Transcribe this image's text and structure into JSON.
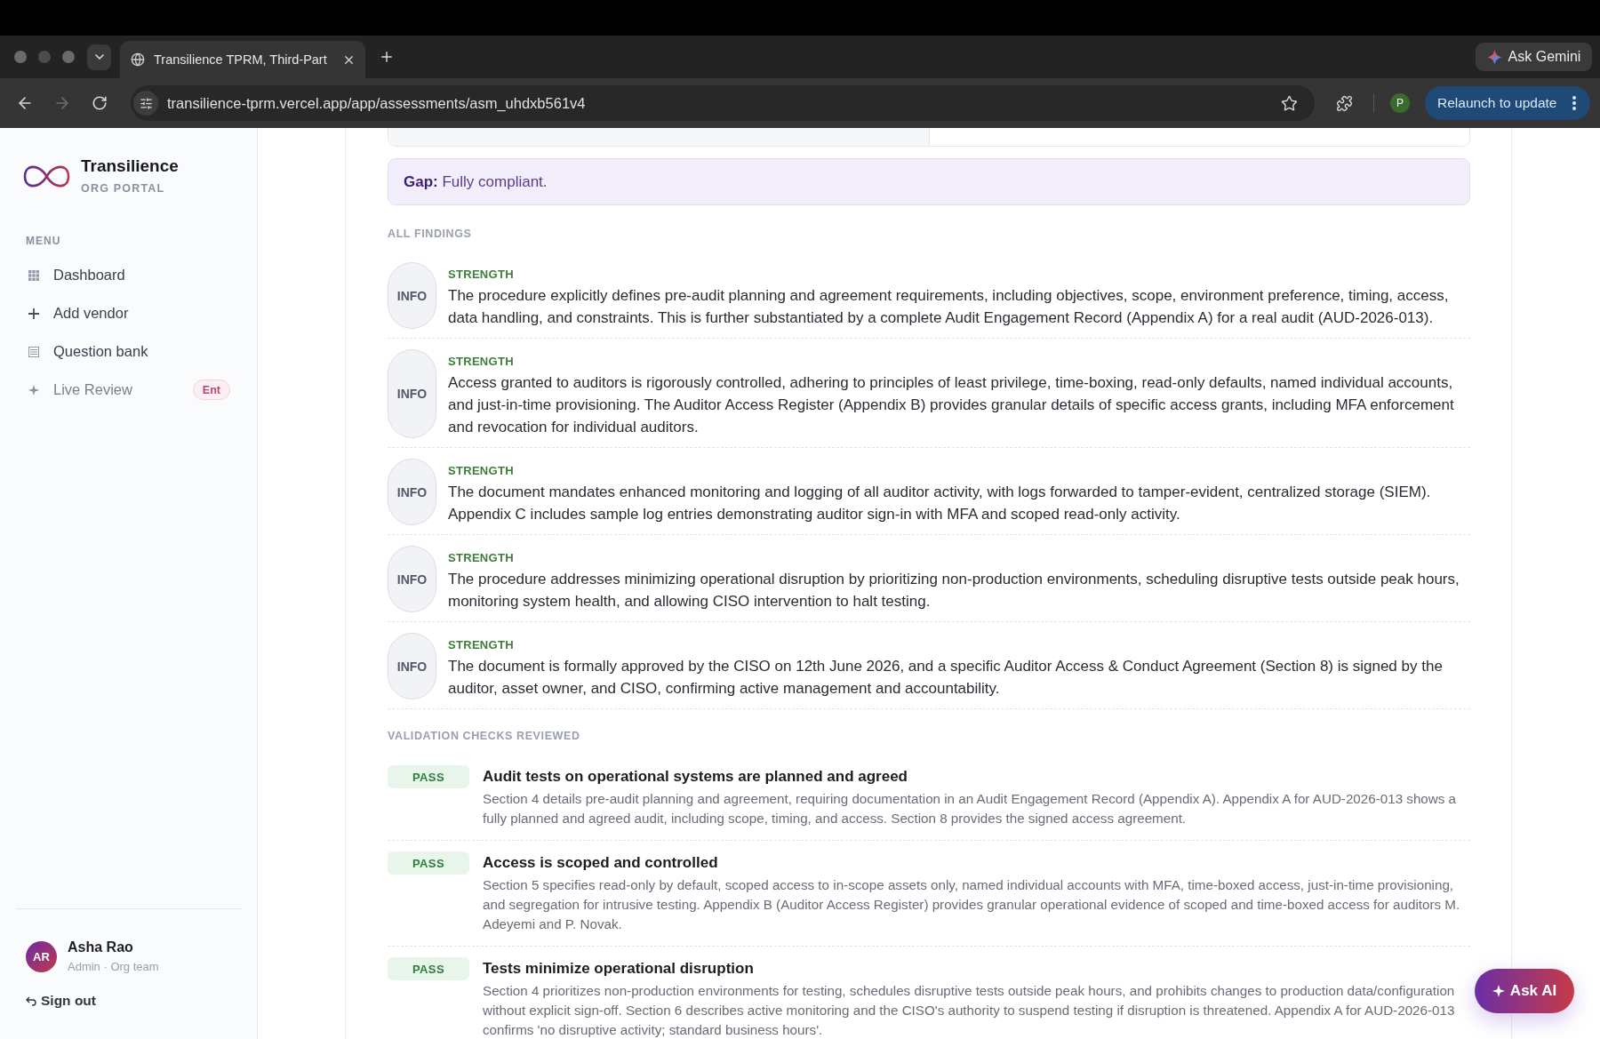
{
  "browser": {
    "tabs": [
      {
        "title": "Transilience TPRM, Third-Part",
        "selected": true
      }
    ],
    "nav": [
      {
        "kind": "back",
        "disabled": false
      },
      {
        "kind": "forward",
        "disabled": true
      },
      {
        "kind": "reload",
        "disabled": false
      }
    ],
    "url": "transilience-tprm.vercel.app/app/assessments/asm_uhdxb561v4",
    "gemini_button": "Ask Gemini",
    "profile_initial": "P",
    "relaunch_button": "Relaunch to update"
  },
  "sidebar": {
    "brand": {
      "name": "Transilience",
      "subtitle": "ORG PORTAL"
    },
    "menu_heading": "MENU",
    "items": [
      {
        "kind": "grid",
        "label": "Dashboard",
        "disabled": false
      },
      {
        "kind": "plus",
        "label": "Add vendor",
        "disabled": false
      },
      {
        "kind": "list",
        "label": "Question bank",
        "disabled": false
      },
      {
        "kind": "sparkle",
        "label": "Live Review",
        "disabled": true,
        "badge": "Ent"
      }
    ],
    "user": {
      "initials": "AR",
      "name": "Asha Rao",
      "role": "Admin · Org team"
    },
    "sign_out": "Sign out"
  },
  "main": {
    "gap": "**Gap:** Fully compliant.",
    "findings_heading": "ALL FINDINGS",
    "findings": [
      {
        "severity": "INFO",
        "category": "STRENGTH",
        "text": "The procedure explicitly defines pre-audit planning and agreement requirements, including objectives, scope, environment preference, timing, access, data handling, and constraints. This is further substantiated by a complete Audit Engagement Record (Appendix A) for a real audit (AUD-2026-013)."
      },
      {
        "severity": "INFO",
        "category": "STRENGTH",
        "text": "Access granted to auditors is rigorously controlled, adhering to principles of least privilege, time-boxing, read-only defaults, named individual accounts, and just-in-time provisioning. The Auditor Access Register (Appendix B) provides granular details of specific access grants, including MFA enforcement and revocation for individual auditors."
      },
      {
        "severity": "INFO",
        "category": "STRENGTH",
        "text": "The document mandates enhanced monitoring and logging of all auditor activity, with logs forwarded to tamper-evident, centralized storage (SIEM). Appendix C includes sample log entries demonstrating auditor sign-in with MFA and scoped read-only activity."
      },
      {
        "severity": "INFO",
        "category": "STRENGTH",
        "text": "The procedure addresses minimizing operational disruption by prioritizing non-production environments, scheduling disruptive tests outside peak hours, monitoring system health, and allowing CISO intervention to halt testing."
      },
      {
        "severity": "INFO",
        "category": "STRENGTH",
        "text": "The document is formally approved by the CISO on 12th June 2026, and a specific Auditor Access & Conduct Agreement (Section 8) is signed by the auditor, asset owner, and CISO, confirming active management and accountability."
      }
    ],
    "checks_heading": "VALIDATION CHECKS REVIEWED",
    "checks": [
      {
        "result": "PASS",
        "title": "Audit tests on operational systems are planned and agreed",
        "text": "Section 4 details pre-audit planning and agreement, requiring documentation in an Audit Engagement Record (Appendix A). Appendix A for AUD-2026-013 shows a fully planned and agreed audit, including scope, timing, and access. Section 8 provides the signed access agreement."
      },
      {
        "result": "PASS",
        "title": "Access is scoped and controlled",
        "text": "Section 5 specifies read-only by default, scoped access to in-scope assets only, named individual accounts with MFA, time-boxed access, just-in-time provisioning, and segregation for intrusive testing. Appendix B (Auditor Access Register) provides granular operational evidence of scoped and time-boxed access for auditors M. Adeyemi and P. Novak."
      },
      {
        "result": "PASS",
        "title": "Tests minimize operational disruption",
        "text": "Section 4 prioritizes non-production environments for testing, schedules disruptive tests outside peak hours, and prohibits changes to production data/configuration without explicit sign-off. Section 6 describes active monitoring and the CISO's authority to suspend testing if disruption is threatened. Appendix A for AUD-2026-013 confirms 'no disruptive activity; standard business hours'."
      }
    ]
  },
  "ask_ai": "Ask AI"
}
